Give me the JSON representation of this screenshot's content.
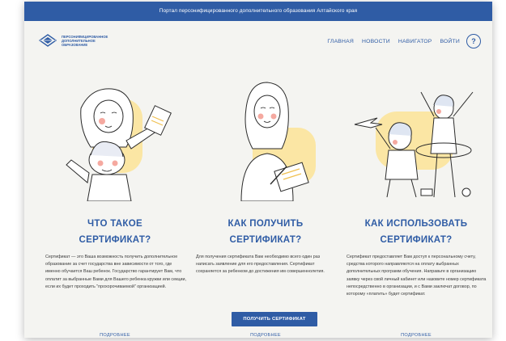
{
  "topbar": {
    "title": "Портал персонифицированного дополнительного образования Алтайского края"
  },
  "logo": {
    "text": "Персонифицированное дополнительное образование"
  },
  "nav": {
    "items": [
      "ГЛАВНАЯ",
      "НОВОСТИ",
      "НАВИГАТОР",
      "ВОЙТИ"
    ],
    "help": "?"
  },
  "columns": [
    {
      "title_line1": "ЧТО ТАКОЕ",
      "title_line2": "СЕРТИФИКАТ?",
      "text": "Сертификат — это Ваша возможность получить дополнительное образование за счет государства вне зависимости от того, где именно обучается Ваш ребенок. Государство гарантирует Вам, что оплатит за выбранные Вами для Вашего ребенка кружки или секции, если их будет проходить \"прохорочиваемой\" организацией.",
      "more": "ПОДРОБНЕЕ"
    },
    {
      "title_line1": "КАК ПОЛУЧИТЬ",
      "title_line2": "СЕРТИФИКАТ?",
      "text": "Для получения сертификата Вам необходимо всего один раз написать заявление для его предоставления. Сертификат сохраняется за ребенком до достижения им совершеннолетия.",
      "button": "ПОЛУЧИТЬ СЕРТИФИКАТ",
      "more": "ПОДРОБНЕЕ"
    },
    {
      "title_line1": "КАК ИСПОЛЬЗОВАТЬ",
      "title_line2": "СЕРТИФИКАТ?",
      "text": "Сертификат предоставляет Вам доступ к персональному счету, средства которого направляются на оплату выбранных дополнительных программ обучения. Направьте в организацию заявку через свой личный кабинет или назовите номер сертификата непосредственно в организации, и с Вами заключат договор, по которому «платить» будет сертификат.",
      "more": "ПОДРОБНЕЕ"
    }
  ],
  "colors": {
    "brand": "#2f5ca5",
    "accent_yellow": "#fbe6a4"
  }
}
